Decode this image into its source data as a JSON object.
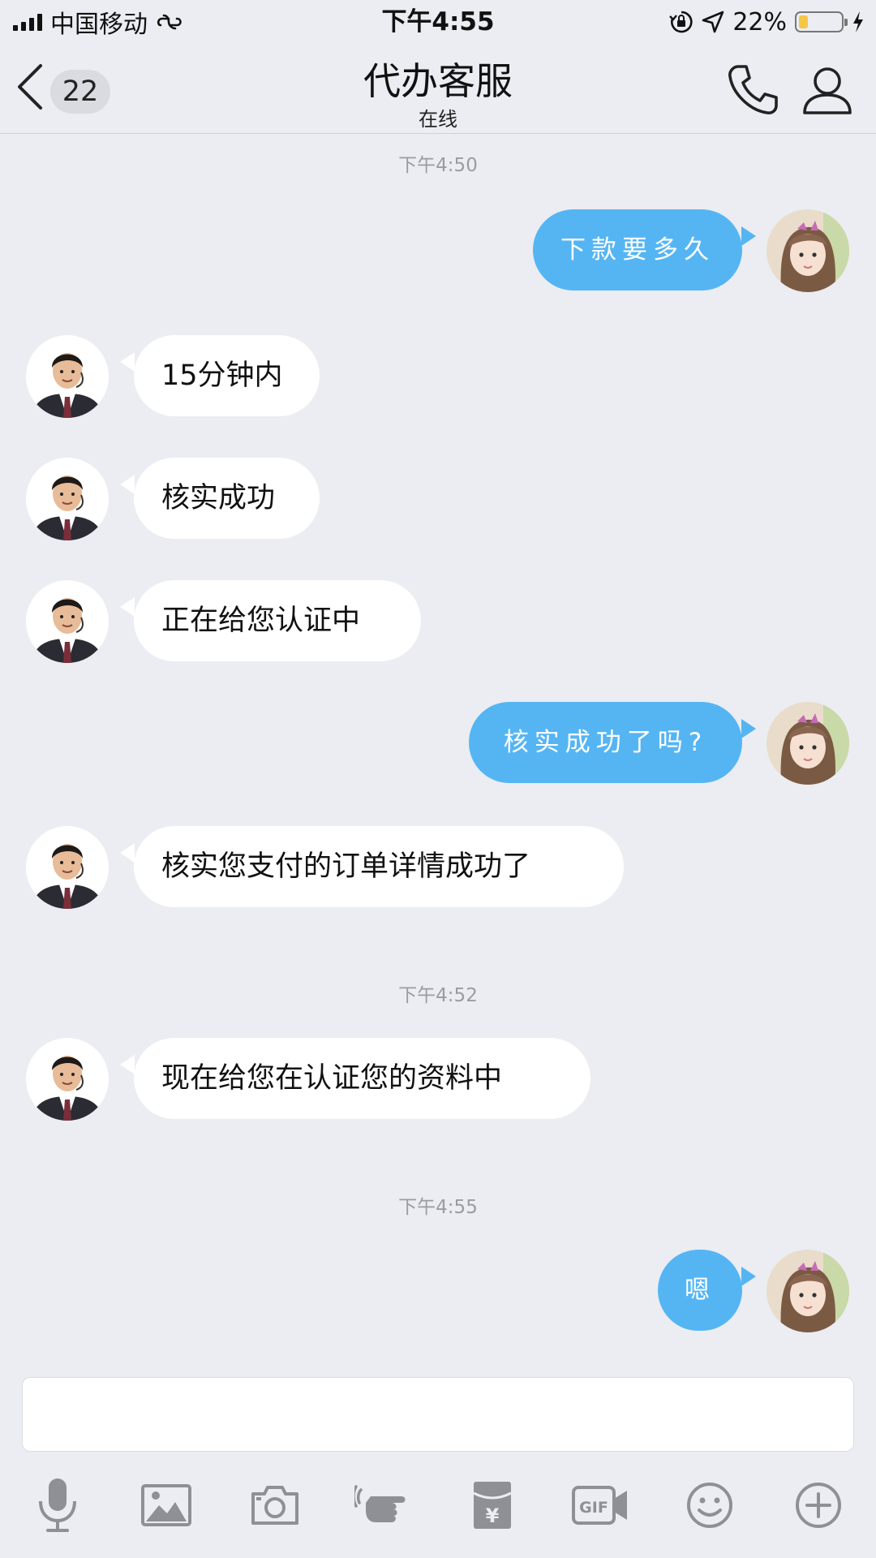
{
  "status_bar": {
    "carrier": "中国移动",
    "time": "下午4:55",
    "battery_text": "22%",
    "battery_level": 0.22,
    "battery_fill_color": "#F6C744"
  },
  "header": {
    "back_badge": "22",
    "title": "代办客服",
    "subtitle": "在线"
  },
  "colors": {
    "outgoing_bubble": "#55B5F3",
    "incoming_bubble": "#FFFFFF",
    "chat_background": "#EBEDF2"
  },
  "messages": [
    {
      "type": "time",
      "text": "下午4:50"
    },
    {
      "type": "out",
      "text": "下款要多久"
    },
    {
      "type": "in",
      "text": "15分钟内"
    },
    {
      "type": "in",
      "text": "核实成功"
    },
    {
      "type": "in",
      "text": "正在给您认证中"
    },
    {
      "type": "out",
      "text": "核实成功了吗?"
    },
    {
      "type": "in",
      "text": "核实您支付的订单详情成功了"
    },
    {
      "type": "time",
      "text": "下午4:52"
    },
    {
      "type": "in",
      "text": "现在给您在认证您的资料中"
    },
    {
      "type": "time",
      "text": "下午4:55"
    },
    {
      "type": "out",
      "text": "嗯"
    }
  ],
  "input": {
    "value": "",
    "placeholder": ""
  },
  "toolbar": {
    "items": [
      "microphone-icon",
      "image-icon",
      "camera-icon",
      "poke-icon",
      "red-packet-icon",
      "gif-icon",
      "emoji-icon",
      "plus-icon"
    ],
    "gif_label": "GIF",
    "red_packet_symbol": "¥"
  }
}
